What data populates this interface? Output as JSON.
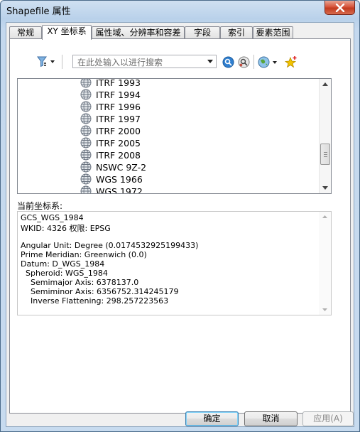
{
  "window": {
    "title": "Shapefile 属性"
  },
  "tabs": [
    {
      "label": "常规",
      "active": false
    },
    {
      "label": "XY 坐标系",
      "active": true
    },
    {
      "label": "属性域、分辨率和容差",
      "active": false
    },
    {
      "label": "字段",
      "active": false
    },
    {
      "label": "索引",
      "active": false
    },
    {
      "label": "要素范围",
      "active": false
    }
  ],
  "toolbar": {
    "search_placeholder": "在此处输入以进行搜索",
    "icons": [
      "filter-icon",
      "search-icon",
      "clear-search-icon",
      "globe-icon",
      "add-favorite-icon"
    ]
  },
  "crs_list": {
    "items": [
      "ITRF 1993",
      "ITRF 1994",
      "ITRF 1996",
      "ITRF 1997",
      "ITRF 2000",
      "ITRF 2005",
      "ITRF 2008",
      "NSWC 9Z-2",
      "WGS 1966",
      "WGS 1972"
    ]
  },
  "current": {
    "label": "当前坐标系:",
    "lines": [
      "GCS_WGS_1984",
      "WKID: 4326 权限: EPSG",
      "",
      "Angular Unit: Degree (0.0174532925199433)",
      "Prime Meridian: Greenwich (0.0)",
      "Datum: D_WGS_1984",
      "  Spheroid: WGS_1984",
      "    Semimajor Axis: 6378137.0",
      "    Semiminor Axis: 6356752.314245179",
      "    Inverse Flattening: 298.257223563"
    ]
  },
  "buttons": {
    "ok": "确定",
    "cancel": "取消",
    "apply": "应用(A)"
  },
  "colors": {
    "accent": "#3399ff",
    "close": "#c23b1f"
  }
}
